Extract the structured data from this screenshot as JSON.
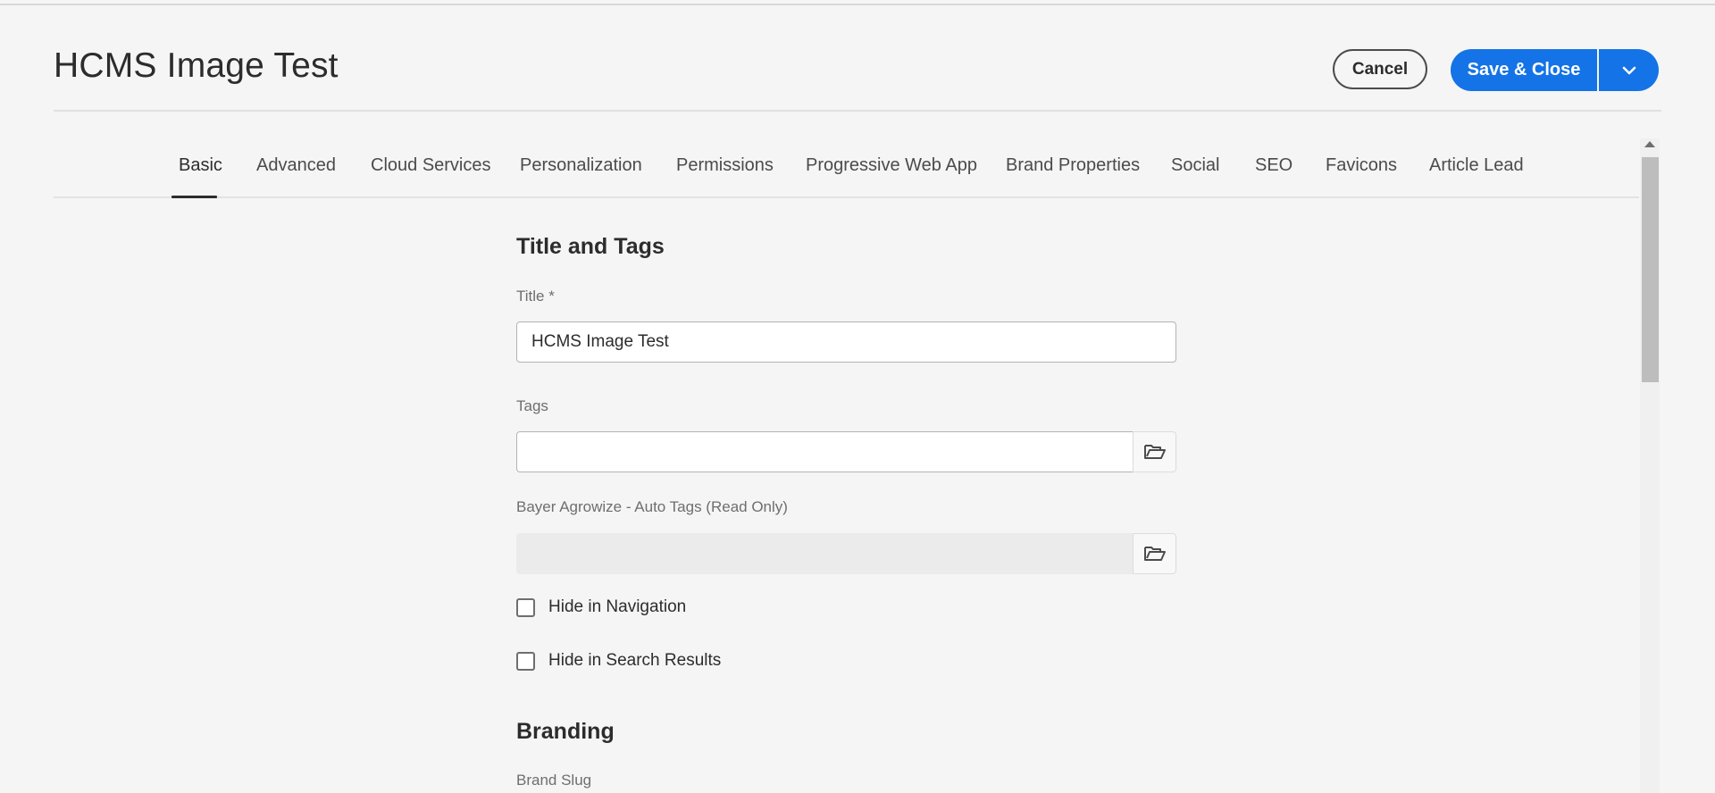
{
  "header": {
    "title": "HCMS Image Test",
    "cancel_label": "Cancel",
    "save_label": "Save & Close"
  },
  "tabs": [
    {
      "label": "Basic",
      "active": true
    },
    {
      "label": "Advanced"
    },
    {
      "label": "Cloud Services"
    },
    {
      "label": "Personalization"
    },
    {
      "label": "Permissions"
    },
    {
      "label": "Progressive Web App"
    },
    {
      "label": "Brand Properties"
    },
    {
      "label": "Social"
    },
    {
      "label": "SEO"
    },
    {
      "label": "Favicons"
    },
    {
      "label": "Article Lead"
    }
  ],
  "sections": {
    "title_tags": {
      "heading": "Title and Tags",
      "title_label": "Title *",
      "title_value": "HCMS Image Test",
      "tags_label": "Tags",
      "tags_value": "",
      "auto_tags_label": "Bayer Agrowize - Auto Tags (Read Only)",
      "auto_tags_value": "",
      "hide_nav_label": "Hide in Navigation",
      "hide_search_label": "Hide in Search Results"
    },
    "branding": {
      "heading": "Branding",
      "brand_slug_label": "Brand Slug"
    }
  },
  "colors": {
    "accent": "#1473e6",
    "background": "#f5f5f5"
  },
  "icons": {
    "folder": "folder-open-icon",
    "chevron": "chevron-down-icon"
  }
}
